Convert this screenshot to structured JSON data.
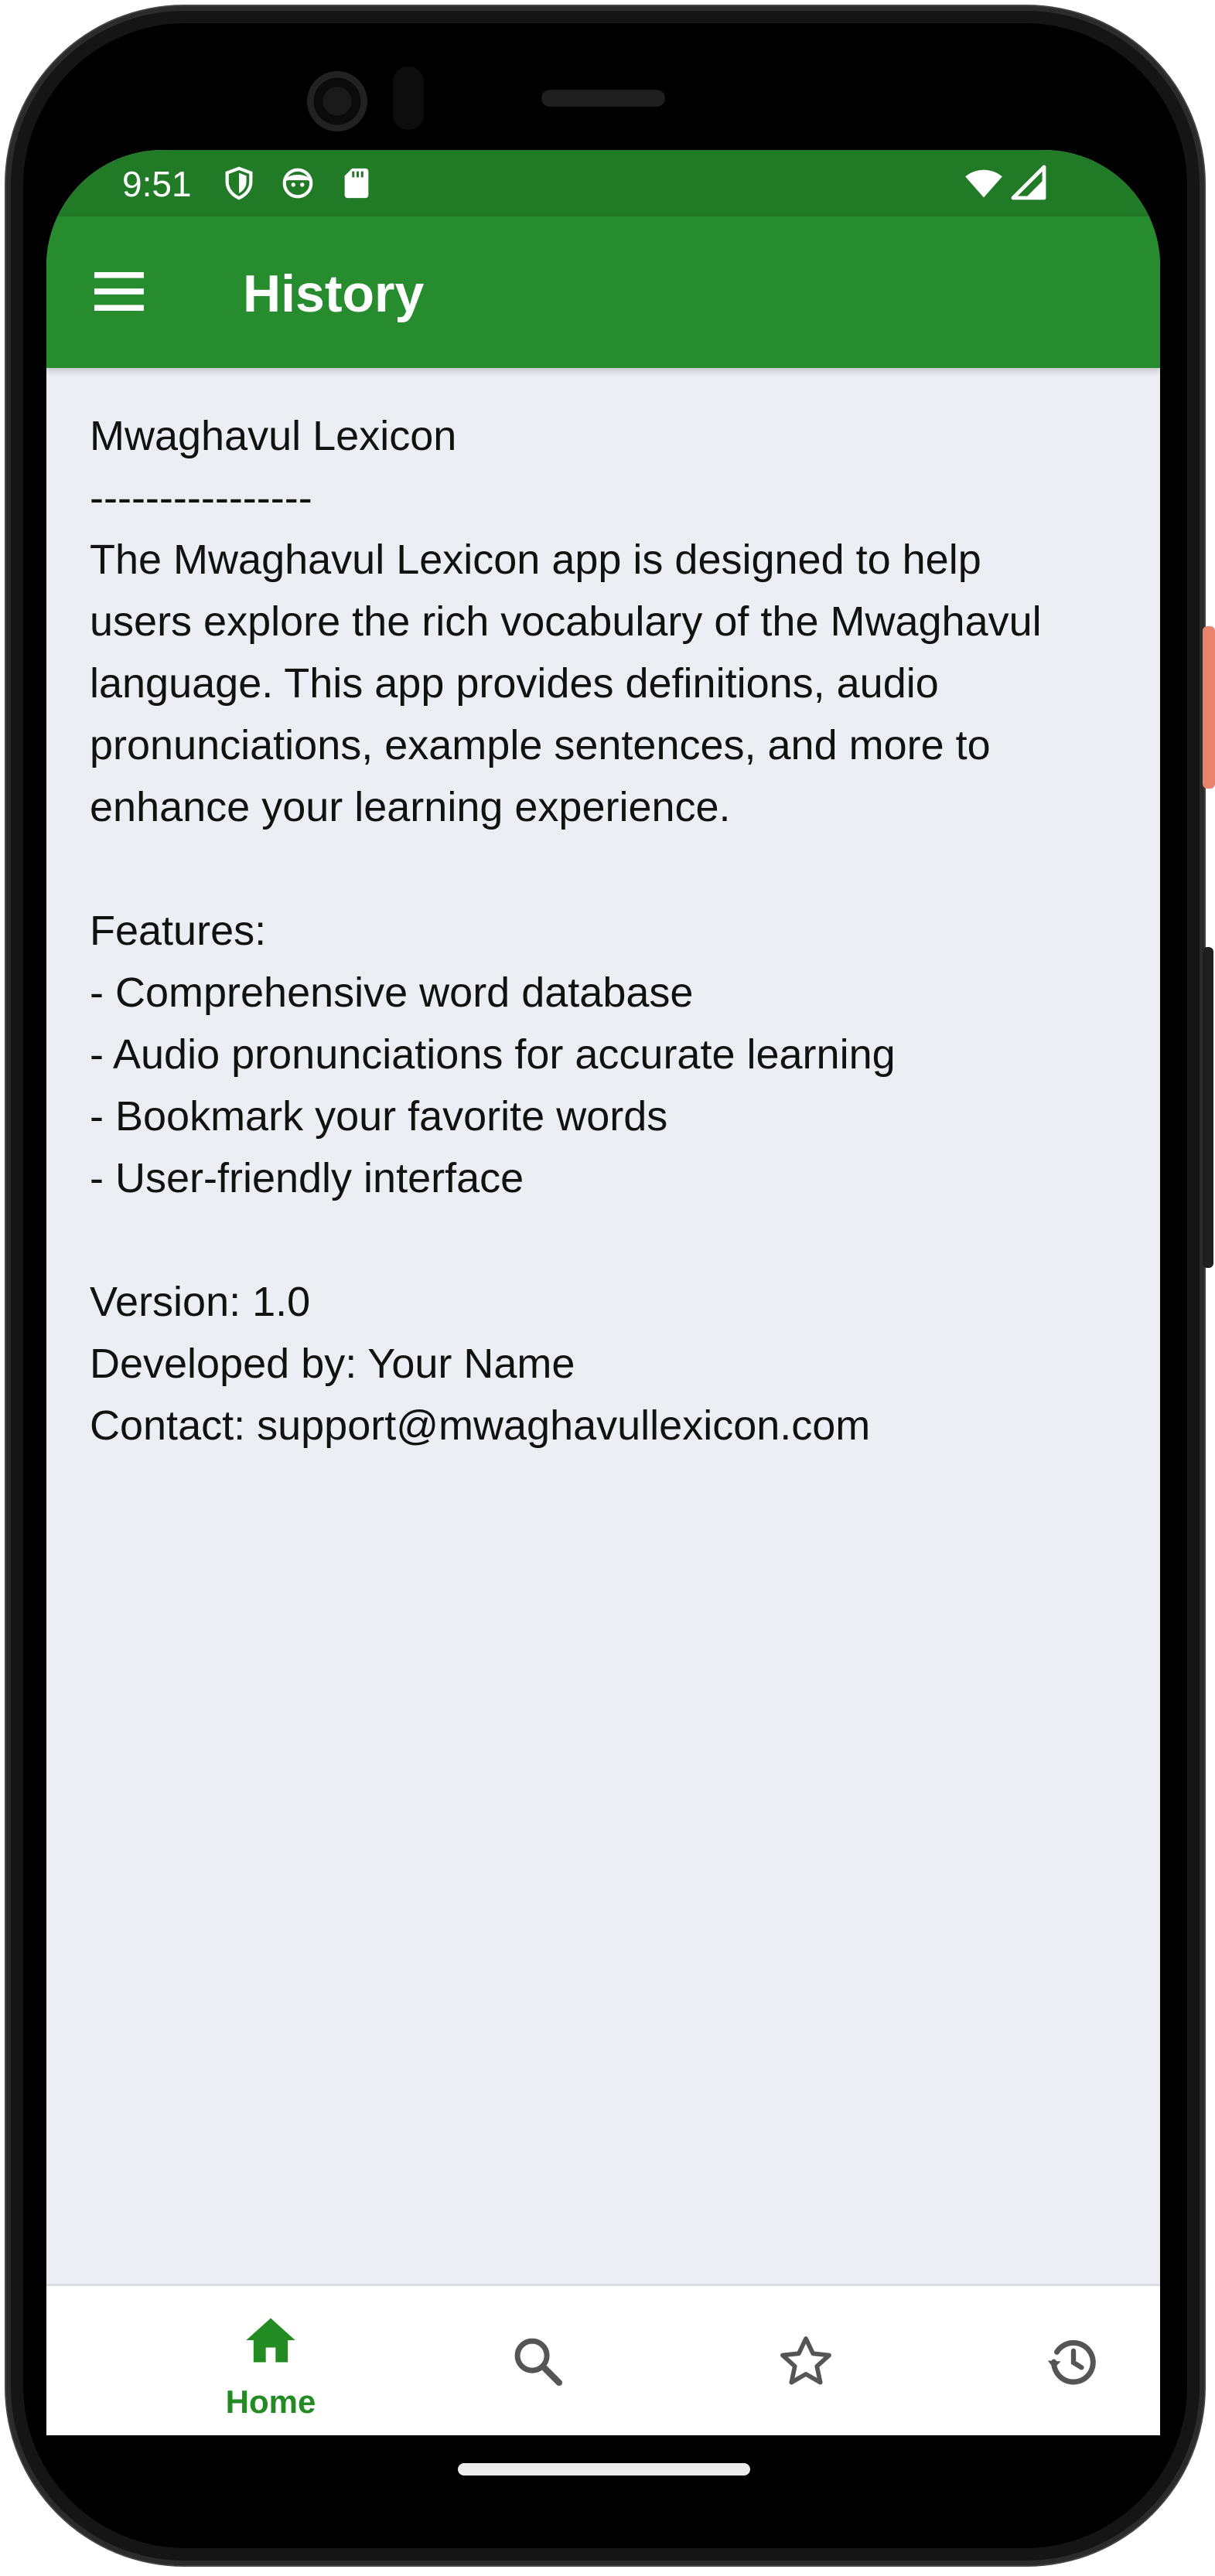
{
  "status_bar": {
    "time": "9:51",
    "left_icons": [
      "shield-icon",
      "face-icon",
      "sd-card-icon"
    ],
    "right_icons": [
      "wifi-icon",
      "cellular-signal-icon"
    ]
  },
  "app_bar": {
    "title": "History",
    "menu_icon": "hamburger-menu-icon"
  },
  "content": {
    "lines": [
      "Mwaghavul Lexicon",
      "----------------",
      "The Mwaghavul Lexicon app is designed to help",
      "users explore the rich vocabulary of the Mwaghavul",
      "language. This app provides definitions, audio",
      "pronunciations, example sentences, and more to",
      "enhance your learning experience.",
      "",
      "Features:",
      "- Comprehensive word database",
      "- Audio pronunciations for accurate learning",
      "- Bookmark your favorite words",
      "- User-friendly interface",
      "",
      "Version: 1.0",
      "Developed by: Your Name",
      "Contact: support@mwaghavullexicon.com"
    ]
  },
  "bottom_nav": {
    "items": [
      {
        "id": "home",
        "label": "Home",
        "icon": "home-icon",
        "active": true
      },
      {
        "id": "search",
        "label": "",
        "icon": "search-icon",
        "active": false
      },
      {
        "id": "favorites",
        "label": "",
        "icon": "star-icon",
        "active": false
      },
      {
        "id": "history",
        "label": "",
        "icon": "history-icon",
        "active": false
      }
    ]
  },
  "colors": {
    "status_bar": "#217a26",
    "app_bar": "#278c2d",
    "content_bg": "#eceef3",
    "nav_active": "#228b22",
    "nav_inactive": "#555555"
  }
}
